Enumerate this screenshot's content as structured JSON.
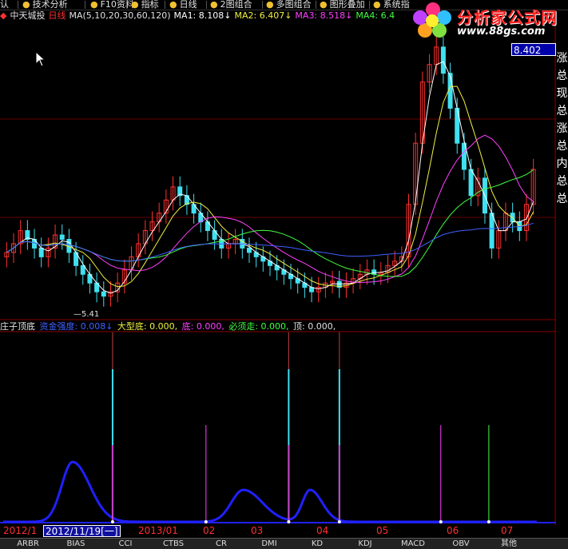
{
  "toolbar": {
    "items": [
      {
        "label": "认",
        "icon": ""
      },
      {
        "label": "技术分析",
        "icon": "●"
      },
      {
        "label": "F10资料",
        "icon": "●"
      },
      {
        "label": "指标",
        "icon": "●"
      },
      {
        "label": "日线",
        "icon": "●"
      },
      {
        "label": "2图组合",
        "icon": "●"
      },
      {
        "label": "多图组合",
        "icon": "●"
      },
      {
        "label": "图形叠加",
        "icon": "●"
      },
      {
        "label": "系统指",
        "icon": "●"
      }
    ]
  },
  "logo": {
    "title": "分析家公式网",
    "url": "www.88gs.com"
  },
  "stock": {
    "name": "中天城投",
    "period": "日线",
    "ma_label": "MA(5,10,20,30,60,120)",
    "ma1": "MA1: 8.108↓",
    "ma2": "MA2: 6.407↓",
    "ma3": "MA3: 8.518↓",
    "ma4": "MA4: 6.4"
  },
  "price_box": "8.402",
  "low_label": "5.41",
  "right_panel": [
    "涨",
    "总",
    "现",
    "总",
    "涨",
    "总",
    "内",
    "总",
    "总"
  ],
  "indicator": {
    "name": "庄子顶底",
    "f1": "资金强度: 0.008↓",
    "f2": "大型底: 0.000,",
    "f3": "底: 0.000,",
    "f4": "必须走: 0.000,",
    "f5": "顶: 0.000,"
  },
  "dates": {
    "d0": "2012/1",
    "selected": "2012/11/19[一]",
    "d1": "2013/01",
    "d2": "02",
    "d3": "03",
    "d4": "04",
    "d5": "05",
    "d6": "06",
    "d7": "07"
  },
  "bottom_tabs": [
    "ARBR",
    "BIAS",
    "CCI",
    "CTBS",
    "CR",
    "DMI",
    "KD",
    "KDJ",
    "MACD",
    "OBV",
    "其他"
  ],
  "colors": {
    "up": "#ff3030",
    "down": "#40e0f0",
    "ma1": "#ffffff",
    "ma2": "#f0f040",
    "ma3": "#ff40ff",
    "ma4": "#40ff40",
    "ma5": "#4060ff",
    "curve": "#2020ff"
  },
  "chart_data": {
    "type": "candlestick",
    "price_high_label": "8.402",
    "price_low_label": "5.41",
    "closes": [
      5.95,
      6.05,
      6.2,
      6.1,
      6.0,
      5.9,
      6.0,
      6.15,
      6.1,
      5.95,
      5.8,
      5.7,
      5.6,
      5.5,
      5.45,
      5.5,
      5.6,
      5.75,
      5.9,
      6.05,
      6.2,
      6.3,
      6.4,
      6.55,
      6.7,
      6.6,
      6.5,
      6.4,
      6.3,
      6.2,
      6.1,
      6.0,
      6.05,
      6.1,
      6.0,
      5.95,
      5.9,
      5.85,
      5.8,
      5.75,
      5.7,
      5.65,
      5.6,
      5.55,
      5.5,
      5.55,
      5.6,
      5.62,
      5.55,
      5.6,
      5.65,
      5.7,
      5.75,
      5.7,
      5.72,
      5.8,
      5.85,
      5.9,
      6.5,
      7.2,
      7.9,
      8.1,
      8.3,
      8.0,
      7.6,
      7.2,
      6.9,
      6.6,
      6.8,
      6.4,
      6.0,
      6.2,
      6.4,
      6.3,
      6.2,
      6.5,
      6.9
    ],
    "indicator_spikes": [
      {
        "t": 0.205,
        "kind": "double"
      },
      {
        "t": 0.38,
        "kind": "magenta"
      },
      {
        "t": 0.535,
        "kind": "double"
      },
      {
        "t": 0.63,
        "kind": "double"
      },
      {
        "t": 0.82,
        "kind": "magenta"
      },
      {
        "t": 0.91,
        "kind": "green"
      }
    ]
  }
}
